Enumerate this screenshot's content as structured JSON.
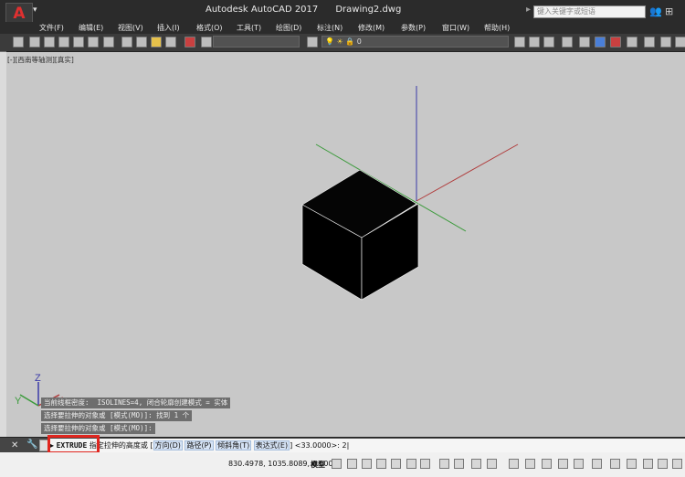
{
  "titlebar": {
    "app_icon_letter": "A",
    "title": "Autodesk AutoCAD 2017      Drawing2.dwg",
    "search_placeholder": "键入关键字或短语"
  },
  "menu": [
    "文件(F)",
    "编辑(E)",
    "视图(V)",
    "插入(I)",
    "格式(O)",
    "工具(T)",
    "绘图(D)",
    "标注(N)",
    "修改(M)",
    "参数(P)",
    "窗口(W)",
    "帮助(H)"
  ],
  "toolbar": {
    "layer_value": "0"
  },
  "viewport": {
    "label": "[-][西南等轴测][真实]"
  },
  "axes_icon": {
    "x": "X",
    "y": "Y",
    "z": "Z"
  },
  "command_history": [
    "当前线框密度:  ISOLINES=4, 闭合轮廓创建模式 = 实体",
    "选择要拉伸的对象或 [模式(MO)]: 找到 1 个",
    "选择要拉伸的对象或 [模式(MO)]:"
  ],
  "command_line": {
    "command": "EXTRUDE",
    "prompt": "指定拉伸的高度或 ",
    "options": [
      "方向(D)",
      "路径(P)",
      "倾斜角(T)",
      "表达式(E)"
    ],
    "default_value": "<33.0000>: ",
    "input": "2"
  },
  "status": {
    "coordinates": "830.4978, 1035.8089, 0.0000",
    "model_label": "模型"
  },
  "colors": {
    "viewport_bg": "#c8c8c8",
    "x_axis": "#b03a3a",
    "y_axis": "#3a9a3a",
    "z_axis": "#3a3aa8",
    "highlight": "#e0261f"
  }
}
